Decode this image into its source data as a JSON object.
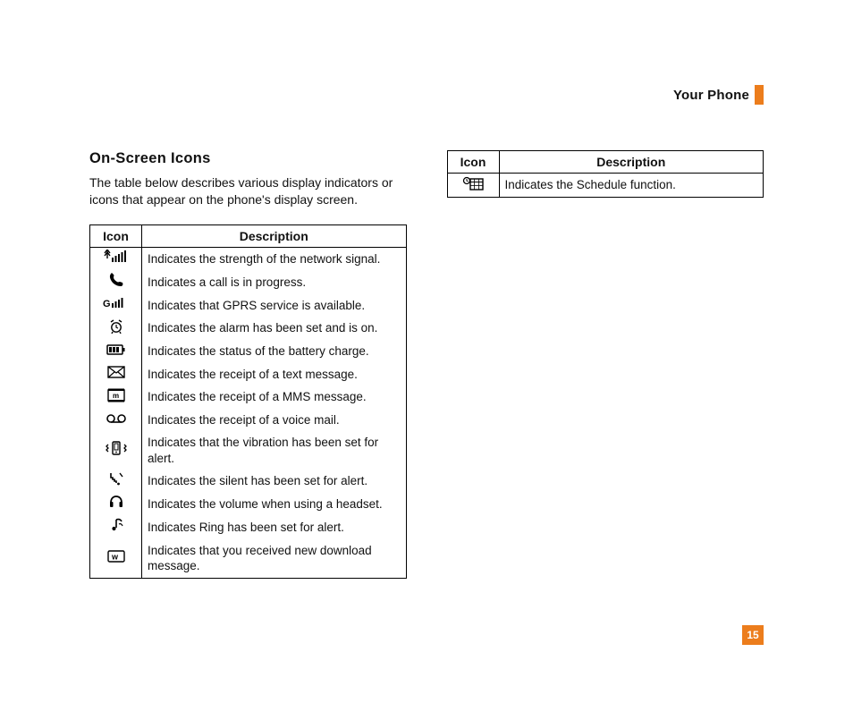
{
  "header": {
    "title": "Your Phone"
  },
  "section": {
    "title": "On-Screen Icons",
    "intro": "The table below describes various display indicators or icons that appear on the phone's display screen."
  },
  "table_headers": {
    "icon": "Icon",
    "description": "Description"
  },
  "table1": {
    "rows": [
      {
        "icon_name": "signal-strength-icon",
        "description": "Indicates the strength of the network signal."
      },
      {
        "icon_name": "call-in-progress-icon",
        "description": "Indicates a call is in progress."
      },
      {
        "icon_name": "gprs-icon",
        "description": "Indicates that GPRS service is available."
      },
      {
        "icon_name": "alarm-icon",
        "description": "Indicates the alarm has been set and is on."
      },
      {
        "icon_name": "battery-icon",
        "description": "Indicates the status of the battery charge."
      },
      {
        "icon_name": "text-message-icon",
        "description": "Indicates the receipt of a text message."
      },
      {
        "icon_name": "mms-message-icon",
        "description": "Indicates the receipt of a MMS message."
      },
      {
        "icon_name": "voicemail-icon",
        "description": "Indicates the receipt of a voice mail."
      },
      {
        "icon_name": "vibration-alert-icon",
        "description": "Indicates that the vibration has been set for alert."
      },
      {
        "icon_name": "silent-alert-icon",
        "description": "Indicates the silent has been set for alert."
      },
      {
        "icon_name": "headset-volume-icon",
        "description": "Indicates the volume when using a headset."
      },
      {
        "icon_name": "ring-alert-icon",
        "description": "Indicates Ring has been set for alert."
      },
      {
        "icon_name": "download-message-icon",
        "description": "Indicates that you received new download message."
      }
    ]
  },
  "table2": {
    "rows": [
      {
        "icon_name": "schedule-icon",
        "description": "Indicates the Schedule function."
      }
    ]
  },
  "page_number": "15"
}
